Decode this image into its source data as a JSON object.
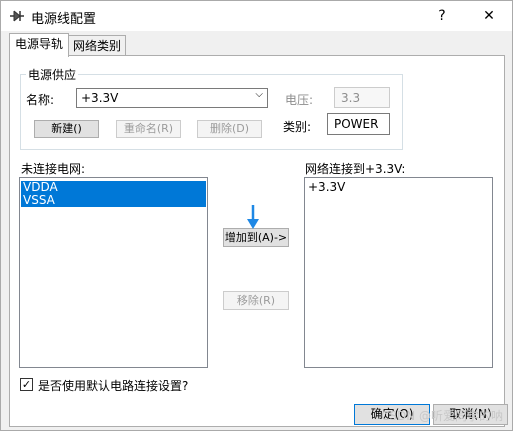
{
  "window": {
    "title": "电源线配置",
    "help_label": "?",
    "close_label": "✕",
    "icon": "power-config-icon"
  },
  "tabs": [
    {
      "label": "电源导轨",
      "active": true
    },
    {
      "label": "网络类别",
      "active": false
    }
  ],
  "power_supply": {
    "group_title": "电源供应",
    "name_label": "名称:",
    "name_value": "+3.3V",
    "voltage_label": "电压:",
    "voltage_value": "3.3",
    "class_label": "类别:",
    "class_value": "POWER",
    "new_button": "新建()",
    "rename_button": "重命名(R)",
    "delete_button": "删除(D)"
  },
  "unconnected": {
    "label": "未连接电网:",
    "items": [
      {
        "label": "VDDA",
        "selected": true
      },
      {
        "label": "VSSA",
        "selected": true
      }
    ]
  },
  "connected": {
    "label": "网络连接到+3.3V:",
    "items": [
      {
        "label": "+3.3V",
        "selected": false
      }
    ]
  },
  "actions": {
    "add_button": "增加到(A)->",
    "remove_button": "移除(R)"
  },
  "options": {
    "use_default_label": "是否使用默认电路连接设置?",
    "use_default_checked": true
  },
  "footer": {
    "ok_button": "确定(O)",
    "cancel_button": "取消(N)",
    "watermark": "CSDN @听爱同学的呐"
  },
  "colors": {
    "selection": "#0078d7",
    "focus_border": "#0078d7",
    "cursor_arrow": "#1e88e5"
  }
}
